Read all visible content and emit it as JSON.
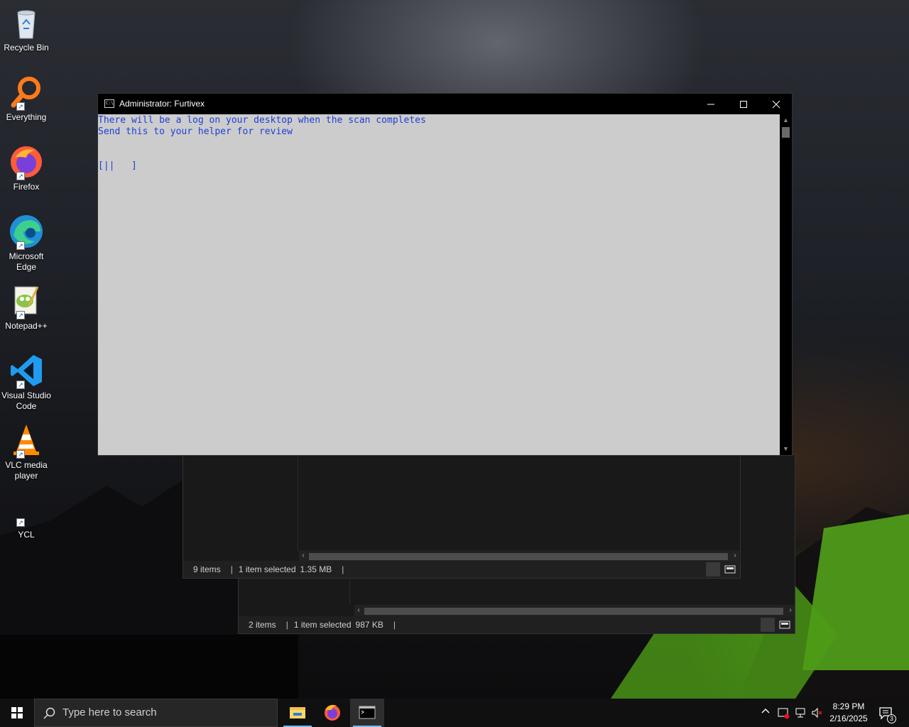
{
  "desktop": {
    "icons": [
      {
        "label": "Recycle Bin"
      },
      {
        "label": "Everything"
      },
      {
        "label": "Firefox"
      },
      {
        "label": "Microsoft Edge"
      },
      {
        "label": "Notepad++"
      },
      {
        "label": "Visual Studio Code"
      },
      {
        "label": "VLC media player"
      },
      {
        "label": "YCL"
      }
    ]
  },
  "explorer_back": {
    "items_count": "2 items",
    "selection": "1 item selected",
    "size": "987 KB"
  },
  "explorer_front": {
    "items_count": "9 items",
    "selection": "1 item selected",
    "size": "1.35 MB"
  },
  "console": {
    "title": "Administrator:  Furtivex",
    "text_color": "#1e3fd6",
    "background": "#cccccc",
    "lines": [
      "There will be a log on your desktop when the scan completes",
      "Send this to your helper for review",
      "",
      "",
      "[||   ]"
    ]
  },
  "taskbar": {
    "search_placeholder": "Type here to search",
    "apps": [
      "file-explorer",
      "firefox",
      "command-prompt"
    ],
    "active_app": "command-prompt",
    "clock_time": "8:29 PM",
    "clock_date": "2/16/2025",
    "notification_count": "3"
  }
}
